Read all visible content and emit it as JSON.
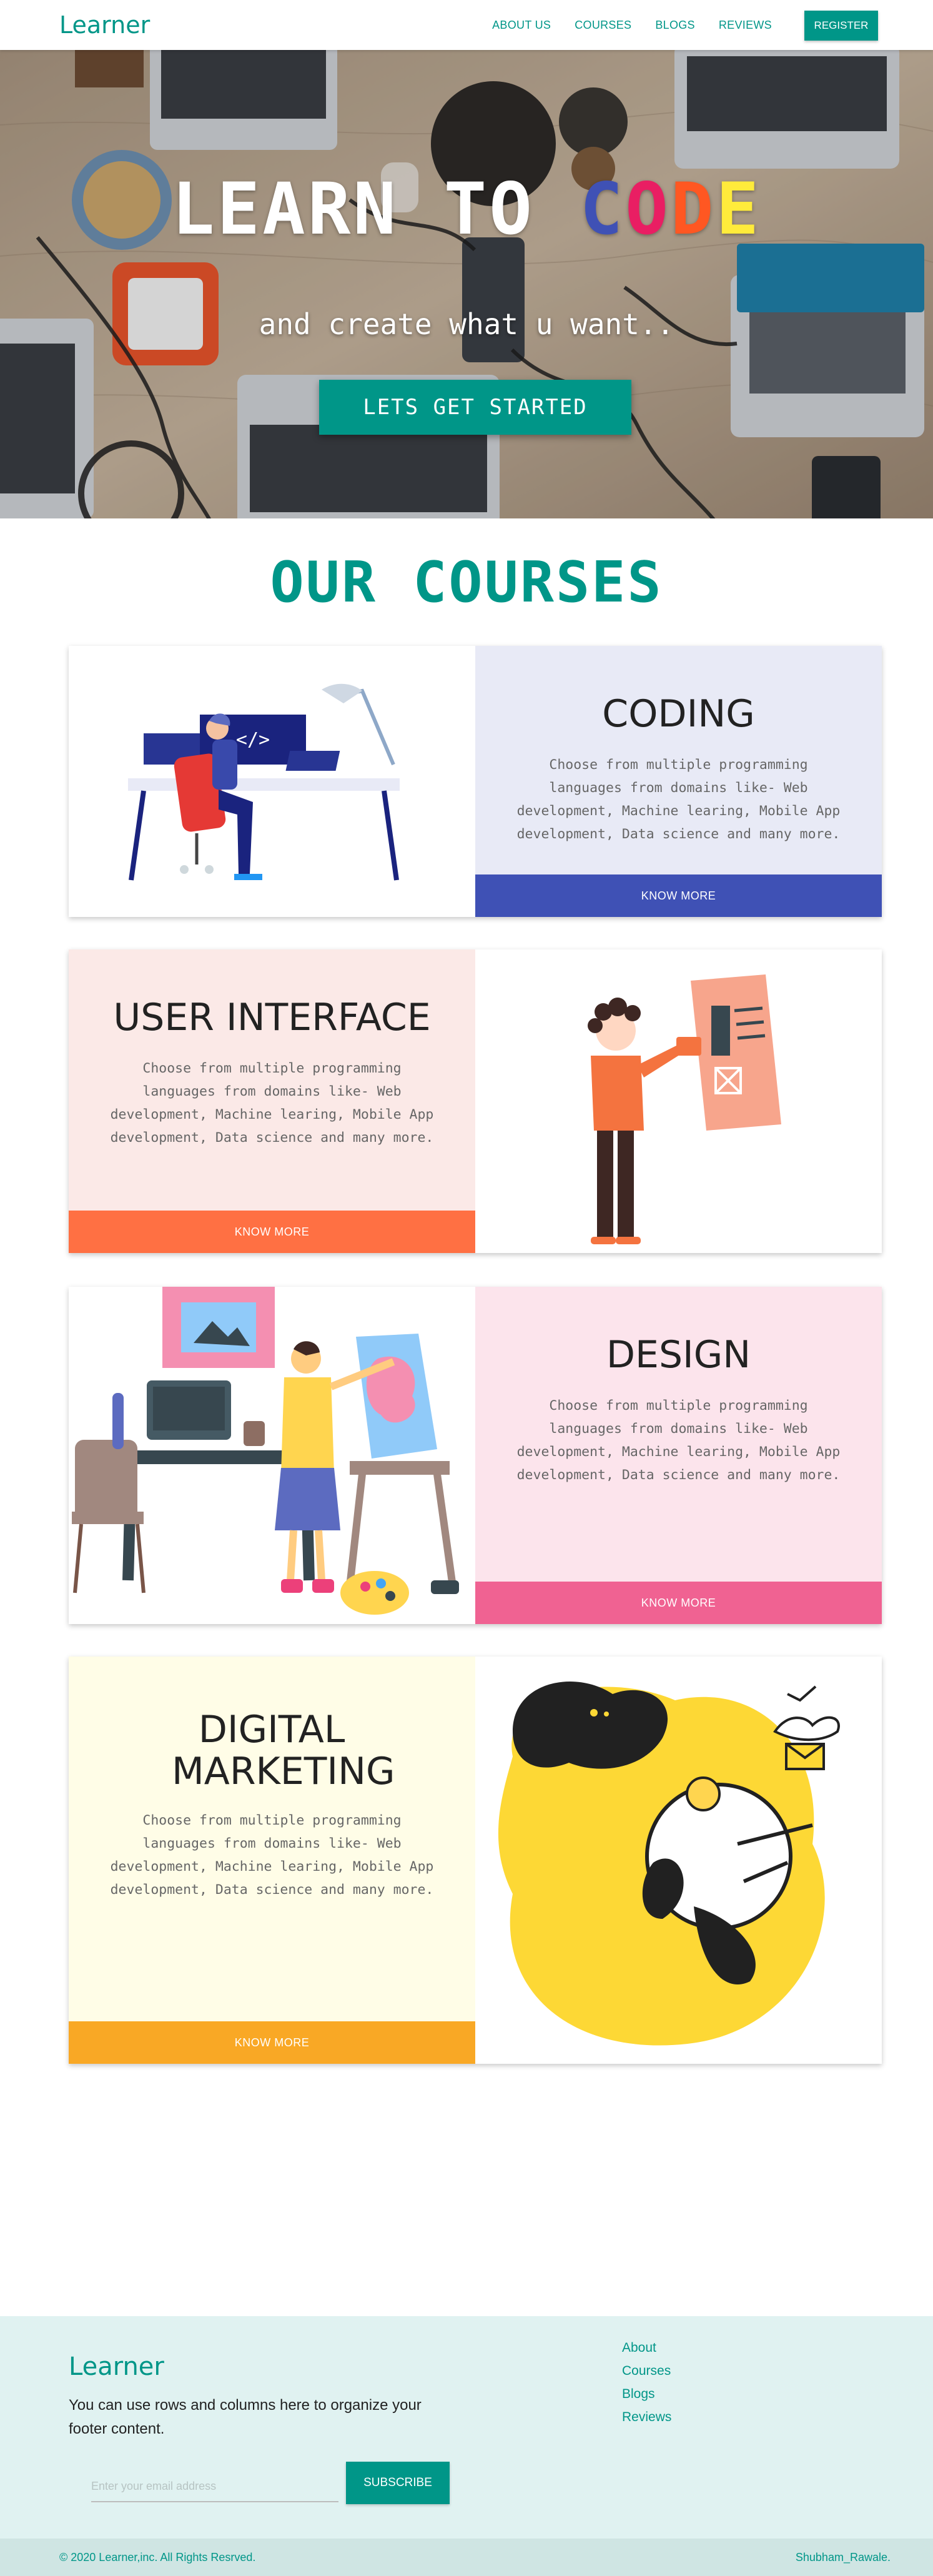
{
  "navbar": {
    "brand": "Learner",
    "links": [
      "ABOUT US",
      "COURSES",
      "BLOGS",
      "REVIEWS"
    ],
    "register": "REGISTER"
  },
  "hero": {
    "title_part1": "LEARN TO ",
    "title_letters": [
      "C",
      "O",
      "D",
      "E"
    ],
    "subtitle": "and create what u want..",
    "cta": "LETS GET STARTED"
  },
  "courses": {
    "heading": "OUR COURSES",
    "description": "Choose from multiple programming languages from domains like- Web development, Machine learing, Mobile App development, Data science and many more.",
    "button": "KNOW MORE",
    "items": [
      {
        "title": "CODING",
        "panel_color": "#e8eaf6",
        "accent": "#3f51b5"
      },
      {
        "title": "USER INTERFACE",
        "panel_color": "#fbe9e7",
        "accent": "#ff7043"
      },
      {
        "title": "DESIGN",
        "panel_color": "#fce4ec",
        "accent": "#f06292"
      },
      {
        "title": "DIGITAL MARKETING",
        "panel_color": "#fffde7",
        "accent": "#f9a825"
      }
    ]
  },
  "footer": {
    "brand": "Learner",
    "description": "You can use rows and columns here to organize your footer content.",
    "links": [
      "About",
      "Courses",
      "Blogs",
      "Reviews"
    ],
    "email_placeholder": "Enter your email address",
    "subscribe": "SUBSCRIBE",
    "copyright": "© 2020 Learner,inc. All Rights Resrved.",
    "author": "Shubham_Rawale."
  }
}
